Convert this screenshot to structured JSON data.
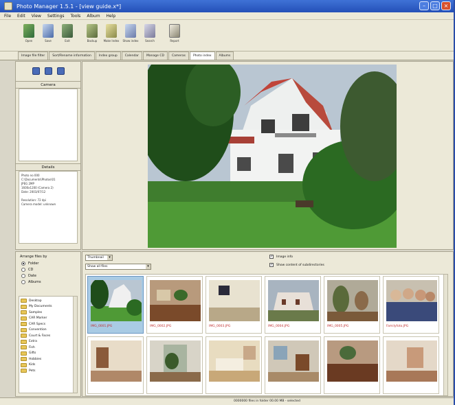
{
  "window": {
    "title": "Photo Manager 1.5.1 - [view guide.x*]"
  },
  "menu": [
    "File",
    "Edit",
    "View",
    "Settings",
    "Tools",
    "Album",
    "Help"
  ],
  "toolbar": [
    "Open",
    "Save",
    "Exit",
    "Backup",
    "Make Index",
    "Show index",
    "Search",
    "Report"
  ],
  "tabs": [
    "Image file filter",
    "Sort/Rename information",
    "Index group",
    "Calendar",
    "Manage CD",
    "Cameras",
    "Photo index",
    "Albums"
  ],
  "active_tab_index": 6,
  "left_panel": {
    "cameras_header": "Camera",
    "details_header": "Details",
    "details_text": "Photo no 000\nC:\\Documents\\Photos\\01\nJPEG 2MP\n1600x1200 (Camera 2)\nDate: 2003/07/12\n\nResolution: 72 dpi\nCamera model: unknown"
  },
  "arrange": {
    "title": "Arrange files by",
    "options": [
      {
        "label": "Folder",
        "checked": true
      },
      {
        "label": "CD",
        "checked": false
      },
      {
        "label": "Date",
        "checked": false
      },
      {
        "label": "Albums",
        "checked": false
      }
    ]
  },
  "folder_tree": [
    "Desktop",
    "My Documents",
    "Samples",
    "CAR Marker",
    "CAR Specs",
    "Convention",
    "Court & Faces",
    "Extra",
    "Fish",
    "Gifts",
    "Hobbies",
    "Kids",
    "Pets"
  ],
  "thumb_controls": {
    "size_select": "Thumbnail",
    "filter_select": "Show all files",
    "check_image_info": "Image info",
    "check_show_content": "Show content of subdirectories"
  },
  "thumbnails": [
    {
      "caption": "IMG_0001.JPG",
      "selected": true
    },
    {
      "caption": "IMG_0002.JPG",
      "selected": false
    },
    {
      "caption": "IMG_0003.JPG",
      "selected": false
    },
    {
      "caption": "IMG_0004.JPG",
      "selected": false
    },
    {
      "caption": "IMG_0005.JPG",
      "selected": false
    },
    {
      "caption": "Familyfoto.JPG",
      "selected": false
    },
    {
      "caption": "",
      "selected": false
    },
    {
      "caption": "",
      "selected": false
    },
    {
      "caption": "",
      "selected": false
    },
    {
      "caption": "",
      "selected": false
    },
    {
      "caption": "",
      "selected": false
    },
    {
      "caption": "",
      "selected": false
    }
  ],
  "status": "0000000 files in folder 00.00 MB - selected",
  "colors": {
    "title_bar": "#2c5cc6",
    "panel_bg": "#ece9d8",
    "selected_thumb": "#a9cbe4",
    "caption": "#c03030"
  }
}
